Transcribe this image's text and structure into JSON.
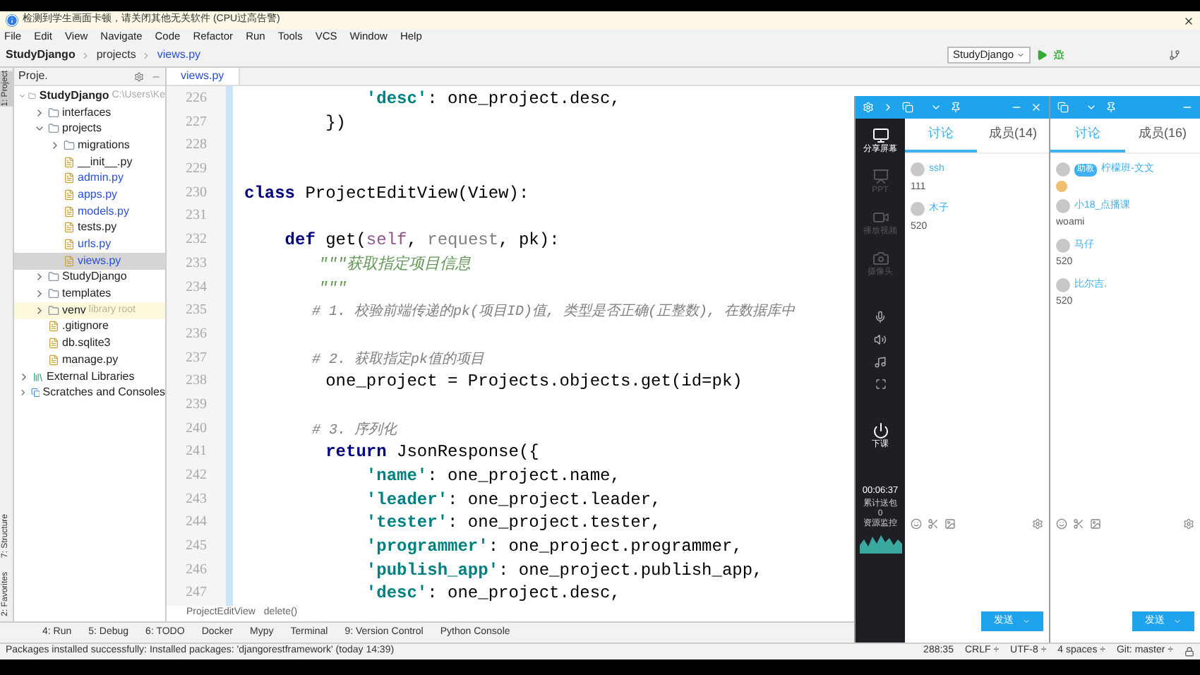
{
  "notification": {
    "text": "检测到学生画面卡顿，请关闭其他无关软件 (CPU过高告警)"
  },
  "menu": [
    "File",
    "Edit",
    "View",
    "Navigate",
    "Code",
    "Refactor",
    "Run",
    "Tools",
    "VCS",
    "Window",
    "Help"
  ],
  "breadcrumb": [
    "StudyDjango",
    "projects",
    "views.py"
  ],
  "run_config": "StudyDjango",
  "project_panel": {
    "title": "Proje.",
    "tree": [
      {
        "name": "StudyDjango",
        "path": "C:\\Users\\Ke",
        "kind": "root",
        "expanded": true,
        "children": [
          {
            "name": "interfaces",
            "kind": "folder",
            "expanded": false
          },
          {
            "name": "projects",
            "kind": "folder",
            "expanded": true,
            "children": [
              {
                "name": "migrations",
                "kind": "folder",
                "expanded": false
              },
              {
                "name": "__init__.py",
                "kind": "file",
                "modified": false,
                "selected": false
              },
              {
                "name": "admin.py",
                "kind": "file",
                "modified": true,
                "selected": false
              },
              {
                "name": "apps.py",
                "kind": "file",
                "modified": true,
                "selected": false
              },
              {
                "name": "models.py",
                "kind": "file",
                "modified": true,
                "selected": false
              },
              {
                "name": "tests.py",
                "kind": "file",
                "modified": false,
                "selected": false
              },
              {
                "name": "urls.py",
                "kind": "file",
                "modified": true,
                "selected": false
              },
              {
                "name": "views.py",
                "kind": "file",
                "modified": true,
                "selected": true
              }
            ]
          },
          {
            "name": "StudyDjango",
            "kind": "folder",
            "expanded": false
          },
          {
            "name": "templates",
            "kind": "folder",
            "expanded": false
          },
          {
            "name": "venv",
            "note": "library root",
            "kind": "folder",
            "expanded": false
          },
          {
            "name": ".gitignore",
            "kind": "file",
            "modified": false,
            "selected": false
          },
          {
            "name": "db.sqlite3",
            "kind": "file",
            "modified": false,
            "selected": false
          },
          {
            "name": "manage.py",
            "kind": "file",
            "modified": false,
            "selected": false
          }
        ]
      },
      {
        "name": "External Libraries",
        "kind": "library",
        "expanded": false
      },
      {
        "name": "Scratches and Consoles",
        "kind": "scratch",
        "expanded": false
      }
    ]
  },
  "side_tabs": [
    {
      "label": "1: Project",
      "selected": true
    },
    {
      "label": "7: Structure",
      "selected": false
    },
    {
      "label": "2: Favorites",
      "selected": false
    }
  ],
  "editor": {
    "tab": "views.py",
    "lines": [
      {
        "number": "226",
        "tokens": [
          {
            "kind": "str",
            "text": "            'desc'"
          },
          {
            "kind": "plain",
            "text": ": one_project.desc,"
          }
        ]
      },
      {
        "number": "227",
        "tokens": [
          {
            "kind": "plain",
            "text": "        })"
          }
        ]
      },
      {
        "number": "228"
      },
      {
        "number": "229"
      },
      {
        "number": "230",
        "tokens": [
          {
            "kind": "kw",
            "text": "class "
          },
          {
            "kind": "plain",
            "text": "ProjectEditView(View):"
          }
        ]
      },
      {
        "number": "231"
      },
      {
        "number": "232",
        "tokens": [
          {
            "kind": "kw",
            "text": "    def "
          },
          {
            "kind": "plain",
            "text": "get("
          },
          {
            "kind": "self",
            "text": "self"
          },
          {
            "kind": "plain",
            "text": ", "
          },
          {
            "kind": "param",
            "text": "request"
          },
          {
            "kind": "plain",
            "text": ", pk):"
          }
        ]
      },
      {
        "number": "233",
        "tokens": [
          {
            "kind": "doc",
            "text": "        \"\"\"获取指定项目信息"
          }
        ]
      },
      {
        "number": "234",
        "tokens": [
          {
            "kind": "doc",
            "text": "        \"\"\""
          }
        ]
      },
      {
        "number": "235",
        "tokens": [
          {
            "kind": "com",
            "text": "        # 1. 校验前端传递的pk(项目ID)值, 类型是否正确(正整数), 在数据库中"
          }
        ]
      },
      {
        "number": "236"
      },
      {
        "number": "237",
        "tokens": [
          {
            "kind": "com",
            "text": "        # 2. 获取指定pk值的项目"
          }
        ]
      },
      {
        "number": "238",
        "tokens": [
          {
            "kind": "plain",
            "text": "        one_project = Projects.objects.get(id=pk)"
          }
        ]
      },
      {
        "number": "239"
      },
      {
        "number": "240",
        "tokens": [
          {
            "kind": "com",
            "text": "        # 3. 序列化"
          }
        ]
      },
      {
        "number": "241",
        "tokens": [
          {
            "kind": "kw",
            "text": "        return "
          },
          {
            "kind": "plain",
            "text": "JsonResponse({"
          }
        ]
      },
      {
        "number": "242",
        "tokens": [
          {
            "kind": "str",
            "text": "            'name'"
          },
          {
            "kind": "plain",
            "text": ": one_project.name,"
          }
        ]
      },
      {
        "number": "243",
        "tokens": [
          {
            "kind": "str",
            "text": "            'leader'"
          },
          {
            "kind": "plain",
            "text": ": one_project.leader,"
          }
        ]
      },
      {
        "number": "244",
        "tokens": [
          {
            "kind": "str",
            "text": "            'tester'"
          },
          {
            "kind": "plain",
            "text": ": one_project.tester,"
          }
        ]
      },
      {
        "number": "245",
        "tokens": [
          {
            "kind": "str",
            "text": "            'programmer'"
          },
          {
            "kind": "plain",
            "text": ": one_project.programmer,"
          }
        ]
      },
      {
        "number": "246",
        "tokens": [
          {
            "kind": "str",
            "text": "            'publish_app'"
          },
          {
            "kind": "plain",
            "text": ": one_project.publish_app,"
          }
        ]
      },
      {
        "number": "247",
        "tokens": [
          {
            "kind": "str",
            "text": "            'desc'"
          },
          {
            "kind": "plain",
            "text": ": one_project.desc,"
          }
        ]
      }
    ],
    "breadcrumb": [
      "ProjectEditView",
      "delete()"
    ]
  },
  "tool_windows": [
    "4: Run",
    "5: Debug",
    "6: TODO",
    "Docker",
    "Mypy",
    "Terminal",
    "9: Version Control",
    "Python Console"
  ],
  "status_bar": {
    "message": "Packages installed successfully: Installed packages: 'djangorestframework' (today 14:39)",
    "items": [
      "288:35",
      "CRLF ÷",
      "UTF-8 ÷",
      "4 spaces ÷",
      "Git: master ÷"
    ]
  },
  "classroom": {
    "sidebar": [
      {
        "label": "分享屏幕",
        "selected": true
      },
      {
        "label": "PPT",
        "selected": false
      },
      {
        "label": "播放视频",
        "selected": false
      },
      {
        "label": "摄像头",
        "selected": false
      }
    ],
    "end_class": "下课",
    "timer": "00:06:37",
    "stats": [
      "累计送包",
      "0",
      "资源监控"
    ],
    "chats": [
      {
        "tabs": [
          {
            "label": "讨论",
            "selected": true
          },
          {
            "label": "成员(14)",
            "selected": false
          }
        ],
        "send": "发送",
        "messages": [
          {
            "name": "ssh",
            "text": "111"
          },
          {
            "name": "木子",
            "text": "520"
          }
        ]
      },
      {
        "tabs": [
          {
            "label": "讨论",
            "selected": true
          },
          {
            "label": "成员(16)",
            "selected": false
          }
        ],
        "send": "发送",
        "messages": [
          {
            "badge": "助教",
            "name": "柠檬班-文文",
            "sticker": true
          },
          {
            "name": "小18_点播课",
            "text": "woami"
          },
          {
            "name": "马仔",
            "text": "520"
          },
          {
            "name": "比尔吉.",
            "text": "520"
          }
        ]
      }
    ]
  }
}
